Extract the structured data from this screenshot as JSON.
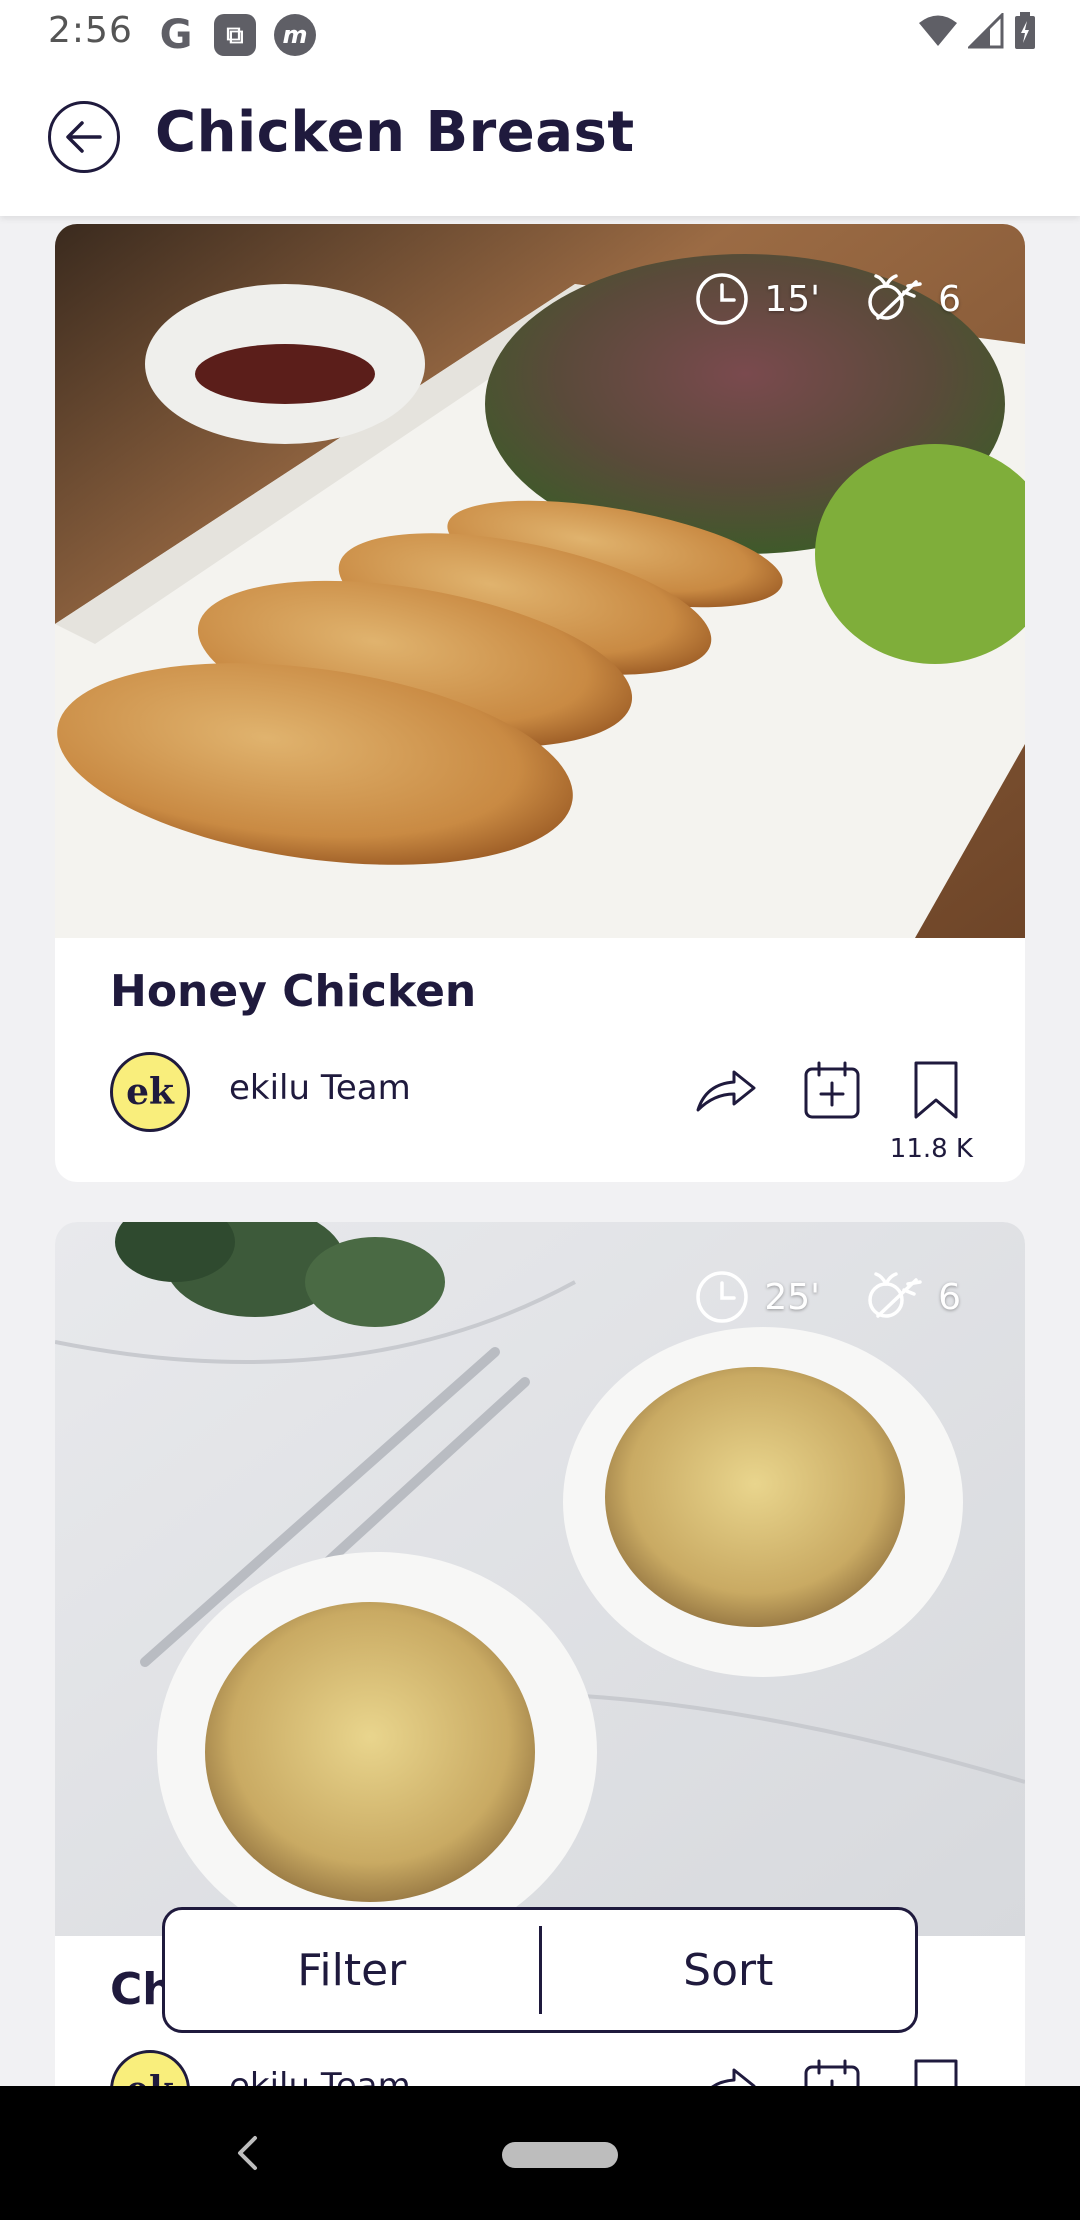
{
  "status_bar": {
    "time": "2:56",
    "app_icons": [
      "G",
      "⧉",
      "m"
    ]
  },
  "header": {
    "title": "Chicken Breast"
  },
  "recipes": [
    {
      "title": "Honey Chicken",
      "time": "15'",
      "ingredients": "6",
      "author": "ekilu Team",
      "author_initials": "ek",
      "save_count": "11.8 K"
    },
    {
      "title": "Ch",
      "time": "25'",
      "ingredients": "6",
      "author": "ekilu Team",
      "author_initials": "ek",
      "save_count": ""
    }
  ],
  "bottom_bar": {
    "filter_label": "Filter",
    "sort_label": "Sort"
  },
  "colors": {
    "primary": "#1f1a3d",
    "avatar_bg": "#f9ee7c"
  }
}
